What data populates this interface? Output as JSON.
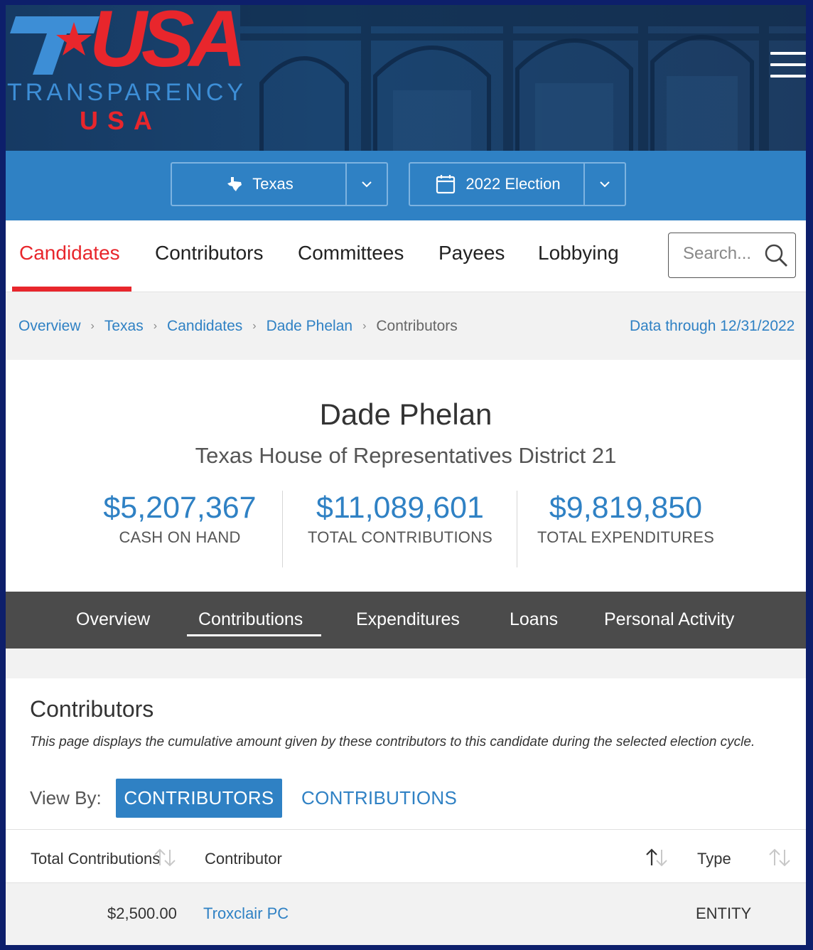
{
  "brand": {
    "logo_usa": "USA",
    "logo_line1": "TRANSPARENCY",
    "logo_line2": "USA",
    "colors": {
      "red": "#e8262c",
      "blue": "#2f81c4",
      "dark": "#4b4b4b"
    }
  },
  "menu_icon": "hamburger-icon",
  "selectors": {
    "state": {
      "label": "Texas",
      "icon": "texas-state-icon"
    },
    "election": {
      "label": "2022 Election",
      "icon": "calendar-icon"
    }
  },
  "nav": {
    "items": [
      "Candidates",
      "Contributors",
      "Committees",
      "Payees",
      "Lobbying"
    ],
    "active": "Candidates",
    "search_placeholder": "Search..."
  },
  "breadcrumb": {
    "items": [
      "Overview",
      "Texas",
      "Candidates",
      "Dade Phelan",
      "Contributors"
    ],
    "data_through": "Data through 12/31/2022"
  },
  "candidate": {
    "name": "Dade Phelan",
    "office": "Texas House of Representatives District 21",
    "stats": [
      {
        "value": "$5,207,367",
        "label": "CASH ON HAND"
      },
      {
        "value": "$11,089,601",
        "label": "TOTAL CONTRIBUTIONS"
      },
      {
        "value": "$9,819,850",
        "label": "TOTAL EXPENDITURES"
      }
    ]
  },
  "tabs": {
    "items": [
      "Overview",
      "Contributions",
      "Expenditures",
      "Loans",
      "Personal Activity"
    ],
    "active": "Contributions"
  },
  "section": {
    "title": "Contributors",
    "description": "This page displays the cumulative amount given by these contributors to this candidate during the selected election cycle.",
    "view_by_label": "View By:",
    "view_contributors": "CONTRIBUTORS",
    "view_contributions": "CONTRIBUTIONS"
  },
  "table": {
    "headers": [
      "Total Contributions",
      "Contributor",
      "Type"
    ],
    "rows": [
      {
        "total": "$2,500.00",
        "contributor": "Troxclair PC",
        "type": "ENTITY"
      }
    ]
  }
}
